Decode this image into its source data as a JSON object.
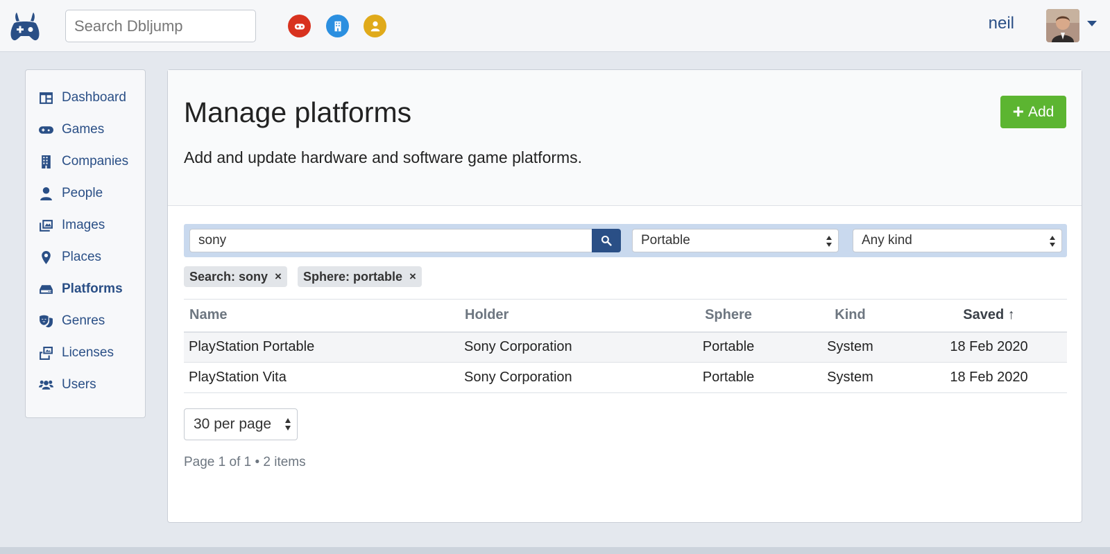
{
  "topbar": {
    "search_placeholder": "Search Dbljump",
    "quick_links": [
      {
        "icon": "gamepad-icon",
        "color": "#d8321f"
      },
      {
        "icon": "building-icon",
        "color": "#2b8fe0"
      },
      {
        "icon": "person-icon",
        "color": "#e0aa1a"
      }
    ],
    "user": {
      "name": "neil"
    }
  },
  "sidebar": {
    "items": [
      {
        "label": "Dashboard",
        "icon": "dashboard-icon"
      },
      {
        "label": "Games",
        "icon": "gamepad-icon"
      },
      {
        "label": "Companies",
        "icon": "building-icon"
      },
      {
        "label": "People",
        "icon": "person-icon"
      },
      {
        "label": "Images",
        "icon": "images-icon"
      },
      {
        "label": "Places",
        "icon": "map-pin-icon"
      },
      {
        "label": "Platforms",
        "icon": "hdd-icon",
        "active": true
      },
      {
        "label": "Genres",
        "icon": "masks-icon"
      },
      {
        "label": "Licenses",
        "icon": "photo-video-icon"
      },
      {
        "label": "Users",
        "icon": "users-icon"
      }
    ]
  },
  "main": {
    "title": "Manage platforms",
    "description": "Add and update hardware and software game platforms.",
    "add_label": "Add",
    "filters": {
      "search_value": "sony",
      "sphere_value": "Portable",
      "kind_value": "Any kind"
    },
    "active_tags": [
      {
        "label": "Search: sony"
      },
      {
        "label": "Sphere: portable"
      }
    ],
    "table": {
      "columns": [
        "Name",
        "Holder",
        "Sphere",
        "Kind",
        "Saved ↑"
      ],
      "rows": [
        [
          "PlayStation Portable",
          "Sony Corporation",
          "Portable",
          "System",
          "18 Feb 2020"
        ],
        [
          "PlayStation Vita",
          "Sony Corporation",
          "Portable",
          "System",
          "18 Feb 2020"
        ]
      ]
    },
    "per_page": "30 per page",
    "pagination_text": "Page 1 of 1 • 2 items"
  },
  "colors": {
    "accent": "#2a4f86",
    "add_button": "#5cb531",
    "filter_bar": "#c9d9ee"
  }
}
